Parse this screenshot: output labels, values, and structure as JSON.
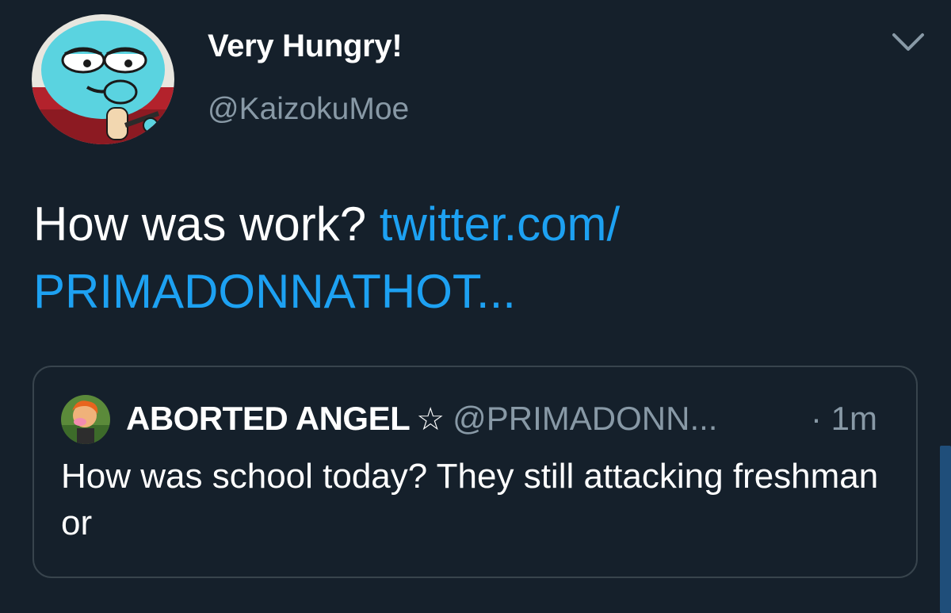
{
  "author": {
    "display_name": "Very Hungry!",
    "handle": "@KaizokuMoe",
    "avatar": "gumball-cartoon-avatar"
  },
  "menu_icon": "chevron-down-icon",
  "tweet": {
    "text": "How was work?",
    "link_line1": "twitter.com/",
    "link_line2": "PRIMADONNATHOT..."
  },
  "quoted_tweet": {
    "display_name": "ABORTED ANGEL",
    "star": "☆",
    "handle": "@PRIMADONN...",
    "time": "· 1m",
    "text": "How was school today? They still attacking freshman or",
    "avatar": "cartoon-character-avatar"
  },
  "colors": {
    "background": "#15202b",
    "link": "#1da1f2",
    "secondary_text": "#8899a6",
    "border": "#38444d"
  }
}
